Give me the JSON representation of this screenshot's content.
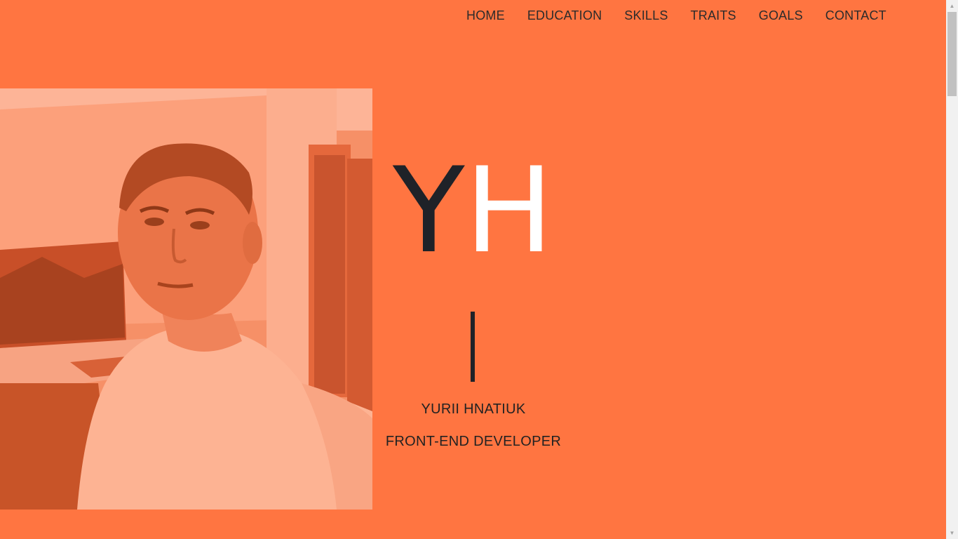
{
  "nav": {
    "items": [
      {
        "label": "HOME"
      },
      {
        "label": "EDUCATION"
      },
      {
        "label": "SKILLS"
      },
      {
        "label": "TRAITS"
      },
      {
        "label": "GOALS"
      },
      {
        "label": "CONTACT"
      }
    ]
  },
  "hero": {
    "monogram_first": "Y",
    "monogram_second": "H",
    "name": "YURII HNATIUK",
    "role": "FRONT-END DEVELOPER"
  },
  "colors": {
    "background": "#ff7541",
    "dark_text": "#1f2228",
    "accent_light": "#ffffff"
  },
  "icons": {
    "scroll_up": "scroll-up-arrow-icon",
    "scroll_down": "scroll-down-arrow-icon"
  }
}
